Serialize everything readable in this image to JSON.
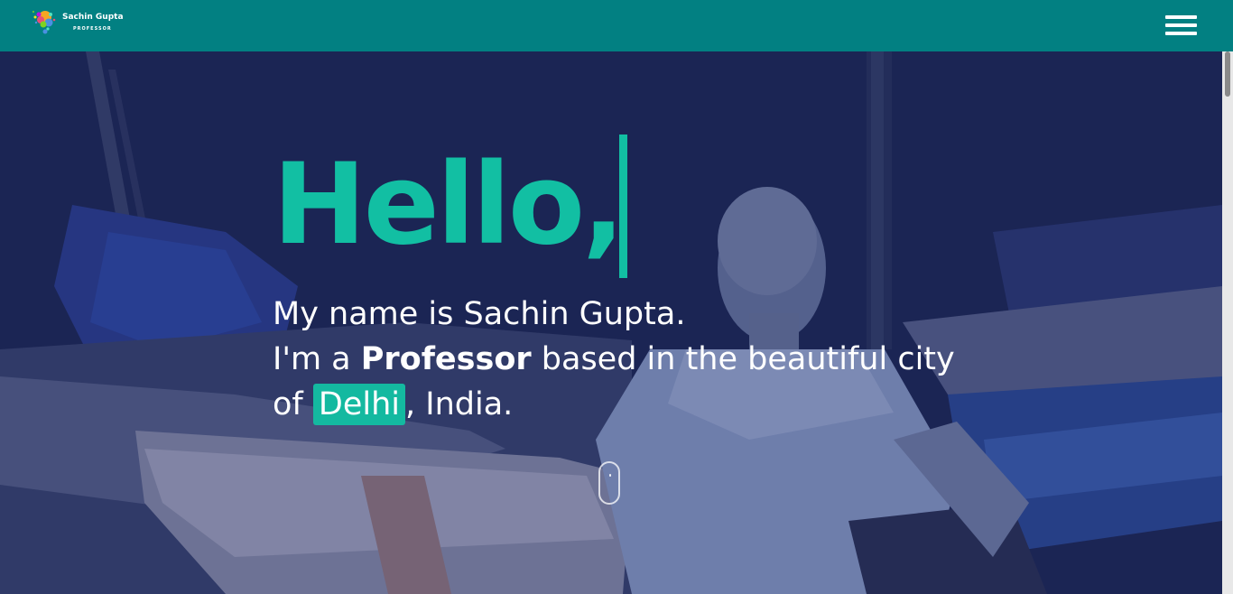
{
  "header": {
    "logo_name": "Sachin Gupta",
    "logo_subtitle": "PROFESSOR",
    "menu_icon": "hamburger-menu-icon",
    "background": "#028082"
  },
  "hero": {
    "greeting": "Hello,",
    "intro_line1": "My name is Sachin Gupta.",
    "intro_line2_prefix": "I'm a ",
    "profession": "Professor",
    "intro_line2_suffix": " based in the beautiful city",
    "intro_line3_prefix": "of ",
    "city": "Delhi",
    "intro_line3_suffix": ", India.",
    "accent_color": "#12bfa3",
    "scroll_icon": "mouse-scroll-icon"
  }
}
